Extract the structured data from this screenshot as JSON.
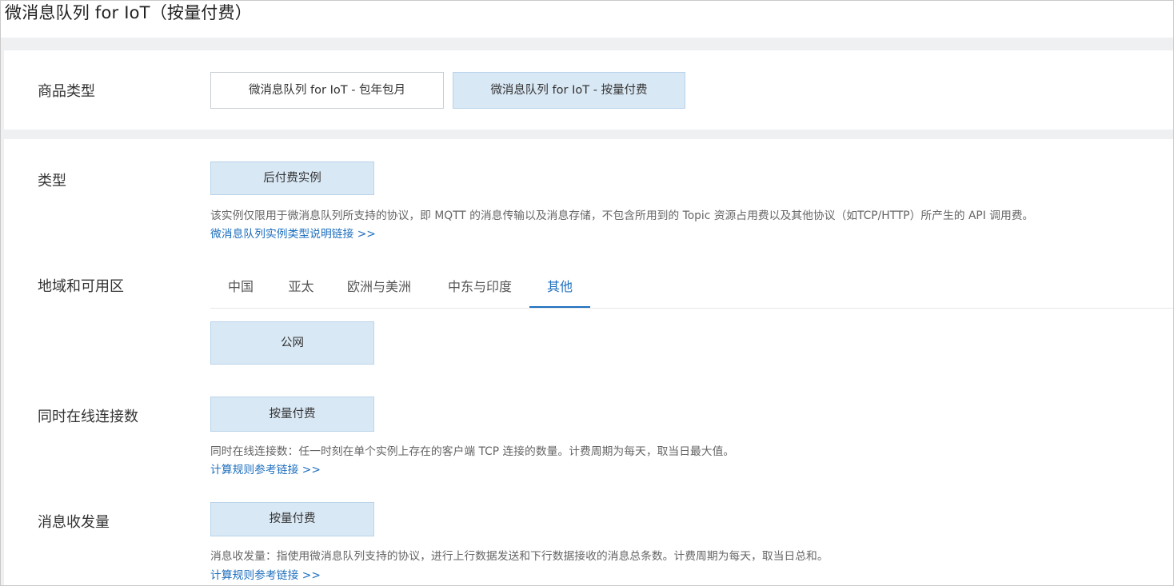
{
  "page_title": "微消息队列 for IoT（按量付费）",
  "product_type": {
    "label": "商品类型",
    "options": [
      {
        "label": "微消息队列 for IoT - 包年包月",
        "selected": false
      },
      {
        "label": "微消息队列 for IoT - 按量付费",
        "selected": true
      }
    ]
  },
  "type": {
    "label": "类型",
    "option": "后付费实例",
    "description": "该实例仅限用于微消息队列所支持的协议，即 MQTT 的消息传输以及消息存储，不包含所用到的 Topic 资源占用费以及其他协议（如TCP/HTTP）所产生的 API 调用费。",
    "link": "微消息队列实例类型说明链接 >>"
  },
  "region": {
    "label": "地域和可用区",
    "tabs": [
      "中国",
      "亚太",
      "欧洲与美洲",
      "中东与印度",
      "其他"
    ],
    "active_tab": "其他",
    "option": "公网"
  },
  "connections": {
    "label": "同时在线连接数",
    "option": "按量付费",
    "description": "同时在线连接数：任一时刻在单个实例上存在的客户端 TCP 连接的数量。计费周期为每天，取当日最大值。",
    "link": "计算规则参考链接 >>"
  },
  "messages": {
    "label": "消息收发量",
    "option": "按量付费",
    "description": "消息收发量：指使用微消息队列支持的协议，进行上行数据发送和下行数据接收的消息总条数。计费周期为每天，取当日总和。",
    "link": "计算规则参考链接 >>"
  },
  "colors": {
    "selected_bg": "#d9e8f5",
    "link": "#1e6fbf"
  }
}
